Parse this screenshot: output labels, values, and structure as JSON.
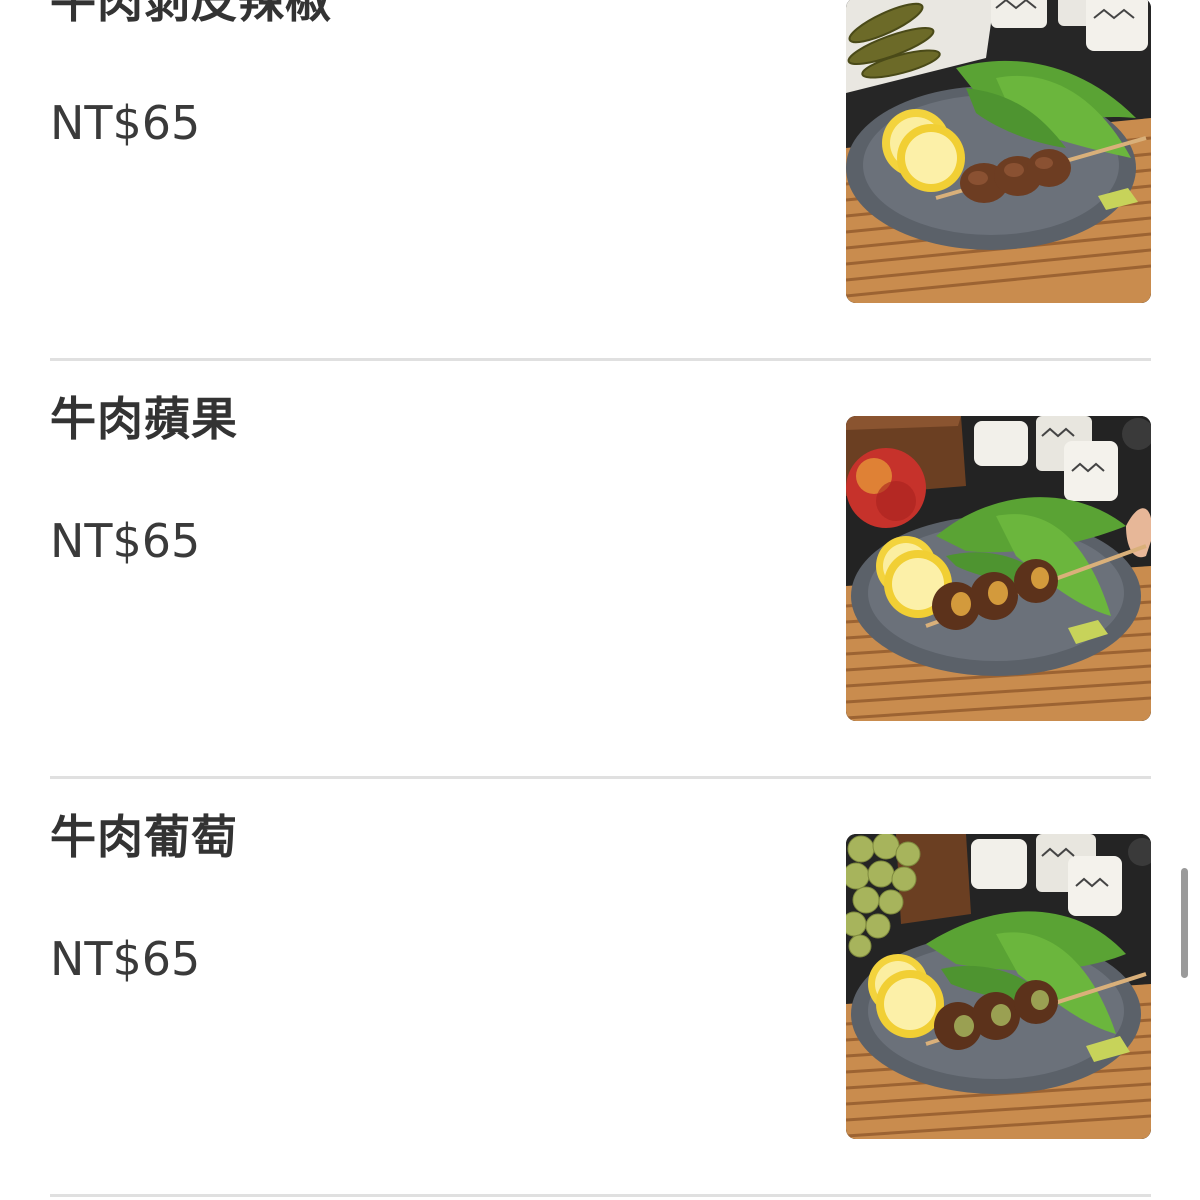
{
  "menu": {
    "items": [
      {
        "name": "牛肉剝皮辣椒",
        "price": "NT$65",
        "photo_icon": "skewer-food-photo",
        "side_food": "pickled-peppers"
      },
      {
        "name": "牛肉蘋果",
        "price": "NT$65",
        "photo_icon": "skewer-food-photo",
        "side_food": "apple"
      },
      {
        "name": "牛肉葡萄",
        "price": "NT$65",
        "photo_icon": "skewer-food-photo",
        "side_food": "grapes"
      }
    ]
  },
  "colors": {
    "text_name": "#333333",
    "text_price": "#3a3a3a",
    "divider": "#e0e0e0",
    "scrollbar": "#9a9a9a"
  }
}
